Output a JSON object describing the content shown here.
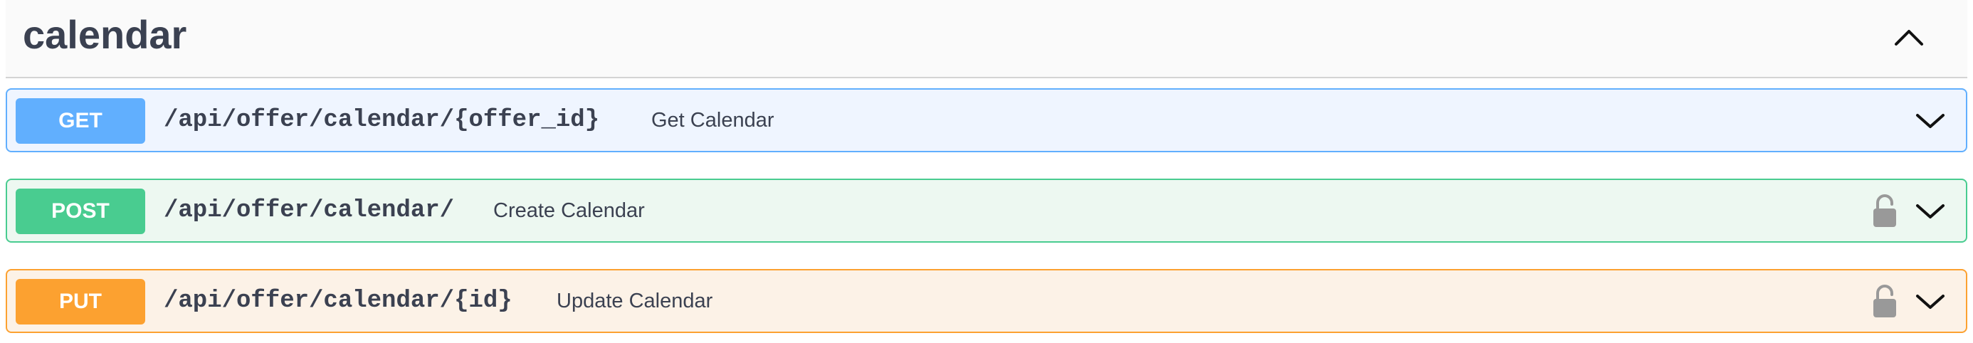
{
  "section": {
    "title": "calendar",
    "collapse_icon": "chevron-up-icon"
  },
  "operations": [
    {
      "method": "GET",
      "path": "/api/offer/calendar/{offer_id}",
      "summary": "Get Calendar",
      "color": "#61affe",
      "locked_icon": null
    },
    {
      "method": "POST",
      "path": "/api/offer/calendar/",
      "summary": "Create Calendar",
      "color": "#49cc90",
      "locked_icon": "lock-icon"
    },
    {
      "method": "PUT",
      "path": "/api/offer/calendar/{id}",
      "summary": "Update Calendar",
      "color": "#fca130",
      "locked_icon": "lock-icon"
    }
  ],
  "colors": {
    "text": "#3b4151",
    "lock": "#999999"
  }
}
